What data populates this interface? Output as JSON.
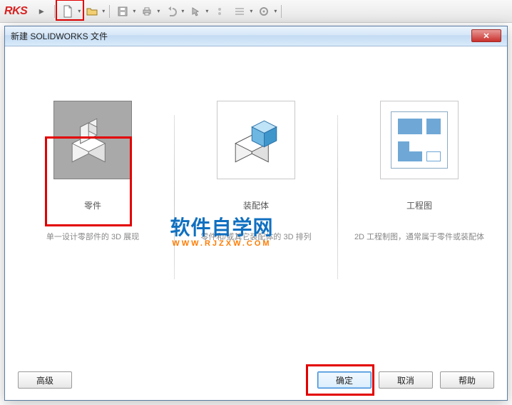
{
  "app": {
    "logo_fragment": "RKS"
  },
  "toolbar": {
    "icons": [
      "triangle-right",
      "new-doc",
      "open-doc",
      "save",
      "print",
      "undo",
      "cursor",
      "rebuild",
      "options",
      "settings"
    ]
  },
  "dialog": {
    "title": "新建 SOLIDWORKS 文件",
    "options": {
      "part": {
        "title": "零件",
        "desc": "单一设计零部件的 3D 展现"
      },
      "assembly": {
        "title": "装配体",
        "desc": "零件和/或其它装配体的 3D 排列"
      },
      "drawing": {
        "title": "工程图",
        "desc": "2D 工程制图，通常属于零件或装配体"
      }
    },
    "buttons": {
      "advanced": "高级",
      "ok": "确定",
      "cancel": "取消",
      "help": "帮助"
    }
  },
  "watermark": {
    "main": "软件自学网",
    "sub": "WWW.RJZXW.COM"
  }
}
